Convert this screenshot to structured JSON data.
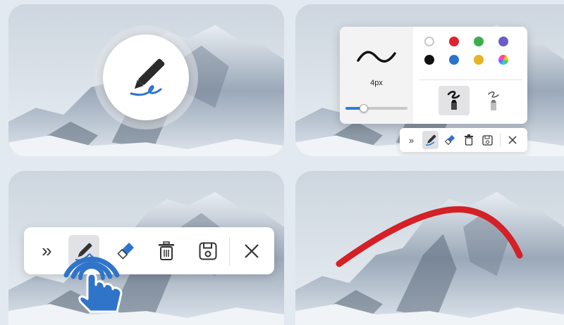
{
  "panels": {
    "p1": {
      "name": "pen-activation"
    },
    "p2": {
      "stroke_size_label": "4px",
      "stroke_size_value": 0.3,
      "colors": [
        "#ffffff",
        "#e0242f",
        "#3dae4a",
        "#6b5ec7",
        "#111111",
        "#2a74cc",
        "#e8b324",
        "rainbow"
      ],
      "pen_types": [
        "marker",
        "pencil"
      ],
      "active_pen_type": "marker"
    },
    "p3": {
      "note": ""
    },
    "p4": {
      "stroke_color": "#d42026"
    }
  },
  "toolbar": {
    "items": [
      "expand",
      "pen",
      "eraser",
      "clear",
      "save",
      "close"
    ],
    "active": "pen",
    "accent": "#2f74c9"
  },
  "colors": {
    "background": "#e3e9f0",
    "accent_blue": "#2f74c9",
    "red_stroke": "#d42026"
  }
}
